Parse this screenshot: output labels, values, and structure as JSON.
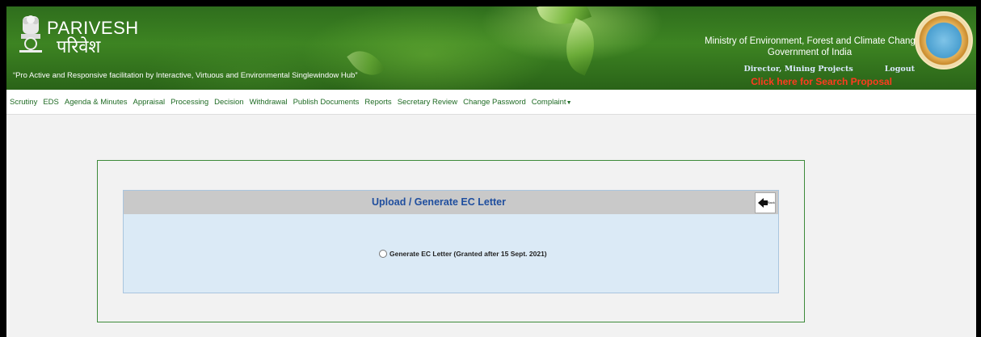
{
  "header": {
    "logo_en": "PARIVESH",
    "logo_hi": "परिवेश",
    "tagline": "“Pro Active and Responsive facilitation by Interactive, Virtuous and Environmental Singlewindow Hub”",
    "ministry": "Ministry of Environment, Forest and Climate Change",
    "government": "Government of India",
    "user_role": "Director, Mining Projects",
    "logout": "Logout",
    "search_proposal": "Click here for Search Proposal",
    "colors": {
      "search_link": "#ff3b1f",
      "header_green": "#3d8422"
    }
  },
  "nav": {
    "items": [
      "Scrutiny",
      "EDS",
      "Agenda & Minutes",
      "Appraisal",
      "Processing",
      "Decision",
      "Withdrawal",
      "Publish Documents",
      "Reports",
      "Secretary Review",
      "Change Password",
      "Complaint"
    ],
    "color": "#1e6a23"
  },
  "panel": {
    "title": "Upload / Generate EC Letter",
    "back_icon": "back-arrow-icon",
    "back_label": "Back",
    "option_label": "Generate EC Letter (Granted after 15 Sept. 2021)",
    "option_selected": false
  }
}
